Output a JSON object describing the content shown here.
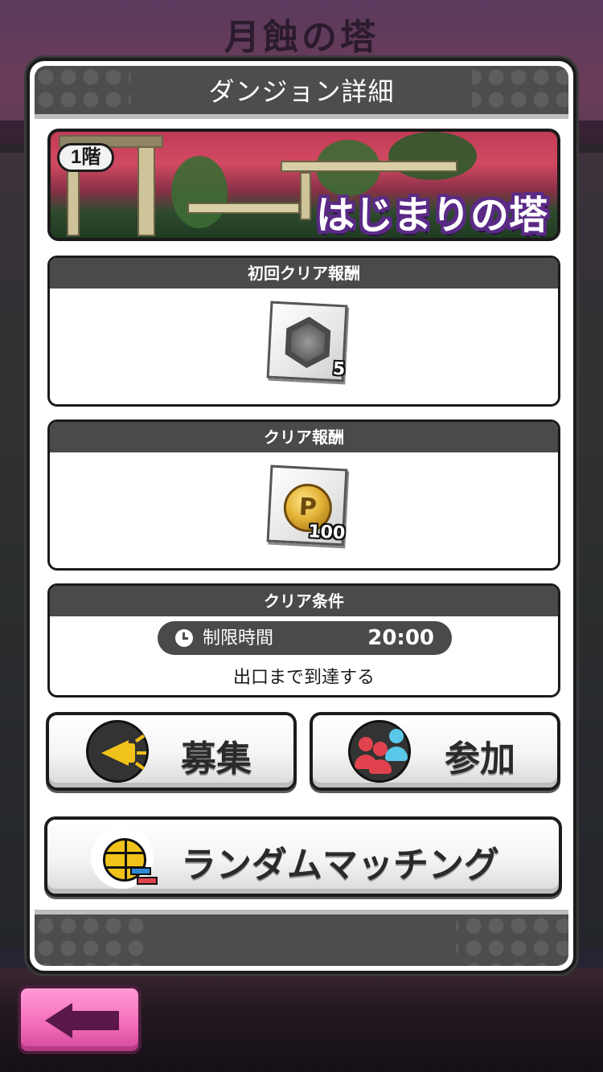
{
  "background": {
    "title": "月蝕の塔"
  },
  "modal": {
    "title": "ダンジョン詳細"
  },
  "banner": {
    "floor": "1階",
    "name": "はじまりの塔"
  },
  "first_clear_reward": {
    "header": "初回クリア報酬",
    "item_icon": "gray-medal-hexagon-icon",
    "quantity": "5"
  },
  "clear_reward": {
    "header": "クリア報酬",
    "item_icon": "gold-p-coin-icon",
    "quantity": "100"
  },
  "clear_condition": {
    "header": "クリア条件",
    "time_limit_label": "制限時間",
    "time_limit_value": "20:00",
    "condition": "出口まで到達する"
  },
  "buttons": {
    "recruit": "募集",
    "join": "参加",
    "random_match": "ランダムマッチング"
  },
  "colors": {
    "panel_header": "#4a4a4a",
    "banner_name_outline": "#5a2a86",
    "back_button": "#f56fbb",
    "back_arrow": "#5a1848",
    "accent_yellow": "#f0c21a"
  }
}
